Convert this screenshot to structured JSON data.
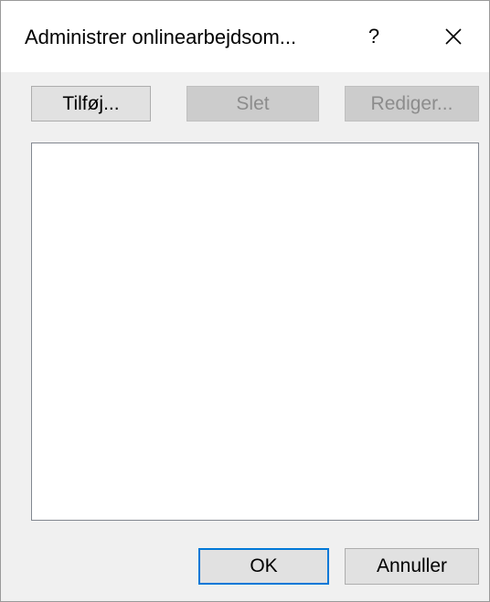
{
  "window": {
    "title": "Administrer onlinearbejdsom...",
    "help_label": "?"
  },
  "toolbar": {
    "add_label": "Tilføj...",
    "delete_label": "Slet",
    "edit_label": "Rediger..."
  },
  "list": {
    "items": []
  },
  "footer": {
    "ok_label": "OK",
    "cancel_label": "Annuller"
  },
  "colors": {
    "dialog_background": "#f0f0f0",
    "titlebar_background": "#ffffff",
    "default_button_border": "#0078d7",
    "disabled_text": "#8c8c8c"
  }
}
